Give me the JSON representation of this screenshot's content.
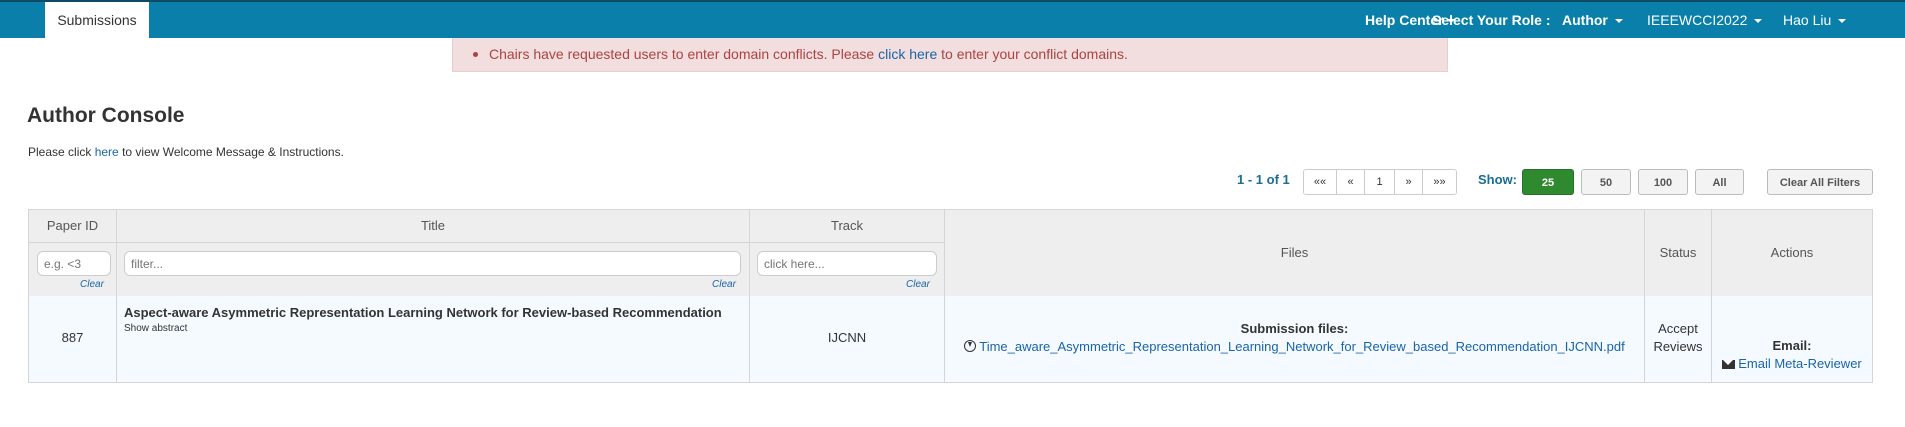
{
  "nav": {
    "tab_submissions": "Submissions",
    "help_center": "Help Center",
    "select_role_label": "Select Your Role :",
    "role": "Author",
    "conference": "IEEEWCCI2022",
    "user": "Hao Liu"
  },
  "alert": {
    "prefix": "Chairs have requested users to enter domain conflicts. Please ",
    "link": "click here",
    "suffix": " to enter your conflict domains."
  },
  "page": {
    "title": "Author Console",
    "intro_prefix": "Please click ",
    "intro_link": "here",
    "intro_suffix": " to view Welcome Message & Instructions."
  },
  "pagination": {
    "info": "1 - 1 of 1",
    "first": "««",
    "prev": "«",
    "page": "1",
    "next": "»",
    "last": "»»",
    "show_label": "Show:",
    "sizes": [
      "25",
      "50",
      "100",
      "All"
    ],
    "active_size": "25",
    "clear_filters": "Clear All Filters"
  },
  "table": {
    "headers": {
      "paper_id": "Paper ID",
      "title": "Title",
      "track": "Track",
      "files": "Files",
      "status": "Status",
      "actions": "Actions"
    },
    "filters": {
      "paper_id_placeholder": "e.g. <3",
      "title_placeholder": "filter...",
      "track_placeholder": "click here...",
      "clear_label": "Clear"
    },
    "rows": [
      {
        "paper_id": "887",
        "title": "Aspect-aware Asymmetric Representation Learning Network for Review-based Recommendation",
        "show_abstract": "Show abstract",
        "track": "IJCNN",
        "files_label": "Submission files:",
        "file_name": "Time_aware_Asymmetric_Representation_Learning_Network_for_Review_based_Recommendation_IJCNN.pdf",
        "status": "Accept",
        "reviews": "Reviews",
        "email_label": "Email:",
        "email_link": "Email Meta-Reviewer"
      }
    ]
  },
  "colors": {
    "navbar": "#0a7fa9",
    "alert_bg": "#f2dede",
    "alert_text": "#a94442",
    "link": "#1a64a8",
    "active_button": "#2f8a2f"
  }
}
